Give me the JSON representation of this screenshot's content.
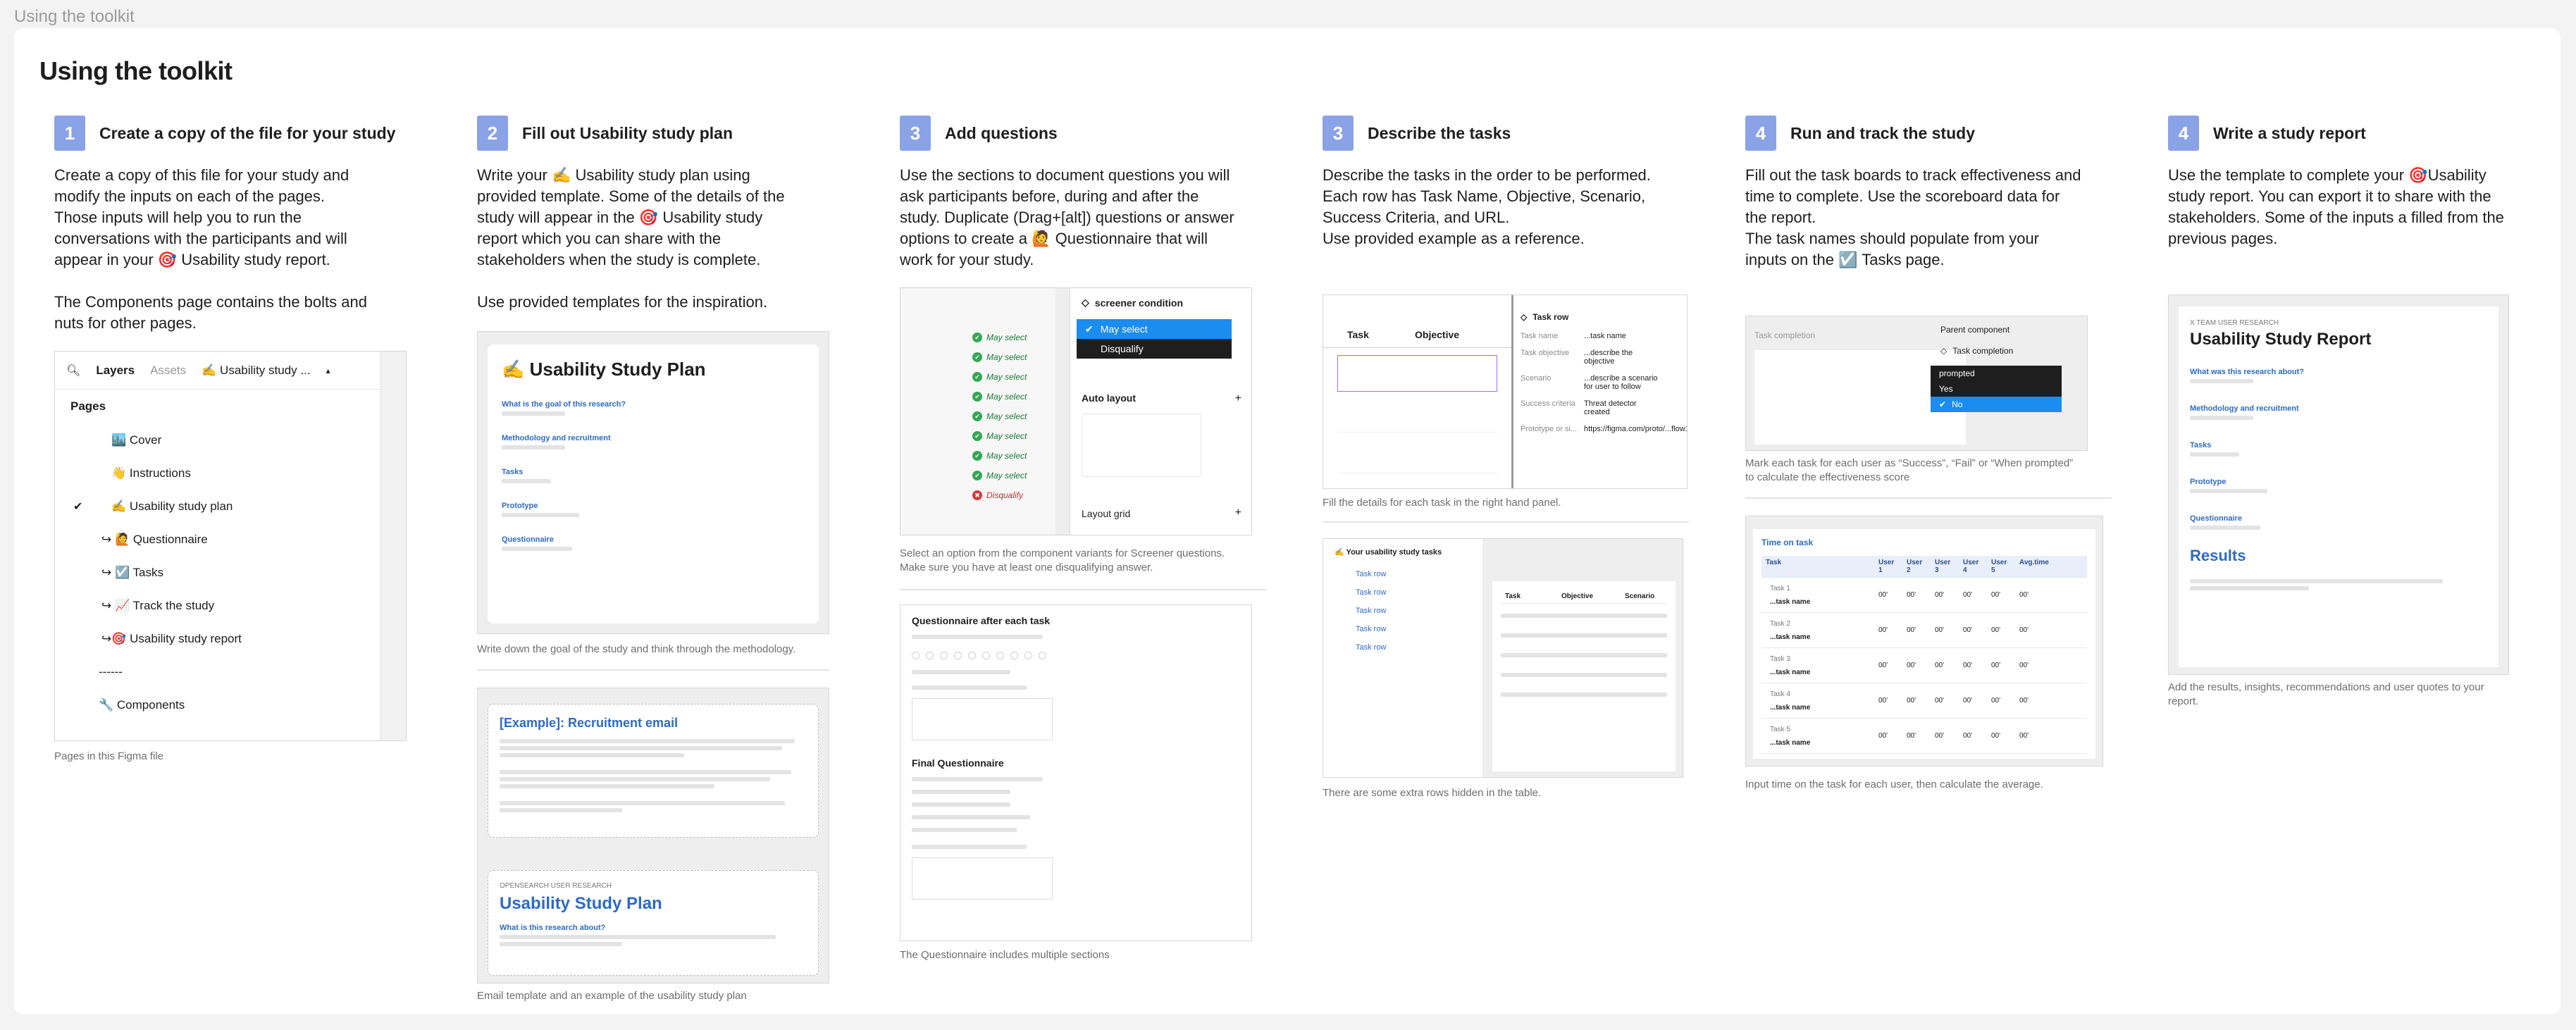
{
  "frame_label": "Using the toolkit",
  "title": "Using the toolkit",
  "columns": [
    {
      "num": "1",
      "title": "Create a copy of the file for your study",
      "desc": "Create a copy of this file for your study and\nmodify the inputs on each of the pages.\nThose inputs will help you to run the\nconversations with the participants and will\nappear in your 🎯 Usability study report.\n\nThe Components page contains the bolts and\nnuts for other pages.",
      "captions": [
        "Pages in this Figma file"
      ]
    },
    {
      "num": "2",
      "title": "Fill out Usability study plan",
      "desc": "Write your ✍️ Usability study plan using\nprovided template. Some of the details of the\nstudy will appear in the 🎯 Usability study\nreport which you can share with the\nstakeholders when the study is complete.\n\nUse provided templates for the inspiration.",
      "captions": [
        "Write down the goal of the study and think through the methodology.",
        "Email template and  an example of the usability study plan"
      ]
    },
    {
      "num": "3",
      "title": "Add questions",
      "desc": "Use the sections to document questions you will\nask participants before, during and after the\nstudy. Duplicate (Drag+[alt]) questions or answer\noptions to create a 🙋 Questionnaire that will\nwork for your study.",
      "captions": [
        "Select an option from the component variants for Screener questions.\nMake sure you have at least one disqualifying answer.",
        "The Questionnaire includes multiple sections"
      ]
    },
    {
      "num": "3",
      "title": "Describe the tasks",
      "desc": "Describe the tasks in the order to be performed.\nEach row has Task Name, Objective, Scenario,\nSuccess Criteria, and URL.\nUse provided example as a reference.",
      "captions": [
        "Fill the details for each task in the right hand panel.",
        "There are some extra rows hidden in the table."
      ]
    },
    {
      "num": "4",
      "title": "Run and track the study",
      "desc": "Fill out the task boards to track effectiveness and\ntime to complete. Use the scoreboard data for\nthe report.\nThe task names should populate from your\ninputs on the ☑️ Tasks page.",
      "captions": [
        "Mark each task for each user as “Success”, “Fail” or “When prompted”\nto calculate the effectiveness score",
        "Input time on the task for each user, then calculate the average."
      ]
    },
    {
      "num": "4",
      "title": "Write a study report",
      "desc": "Use the template to complete your 🎯Usability\nstudy report. You can export it to share with the\nstakeholders. Some of the inputs a filled from the\nprevious pages.",
      "captions": [
        "Add the results, insights, recommendations and user quotes to your\nreport."
      ]
    }
  ],
  "layers_panel": {
    "tabs": [
      "Layers",
      "Assets",
      "✍️ Usability study ..."
    ],
    "pages_label": "Pages",
    "add": "+",
    "pages": [
      "🏙️ Cover",
      "👋 Instructions",
      "✍️ Usability study plan",
      "↪ 🙋 Questionnaire",
      "↪ ☑️ Tasks",
      "↪ 📈 Track the study",
      "↪🎯 Usability study report",
      "------",
      "🔧 Components"
    ]
  },
  "plan_mock": {
    "title": "✍️ Usability Study Plan",
    "sections": [
      "What is the goal of this research?",
      "Methodology and recruitment",
      "Tasks",
      "Prototype",
      "Questionnaire"
    ]
  },
  "email_mock": {
    "title": "[Example]: Recruitment email",
    "eyebrow": "OPENSEARCH USER RESEARCH",
    "plan_title": "Usability Study Plan",
    "question": "What is this research about?"
  },
  "screener_mock": {
    "condition": "screener condition",
    "options": [
      "May select",
      "Disqualify"
    ],
    "auto_layout": "Auto layout",
    "layout_grid": "Layout grid",
    "rows": [
      "May select",
      "May select",
      "May select",
      "May select",
      "May select",
      "May select",
      "May select",
      "May select",
      "Disqualify"
    ]
  },
  "questionnaire_mock": {
    "title1": "Questionnaire after each task",
    "title2": "Final Questionnaire"
  },
  "tasks_mock": {
    "headers": [
      "Task",
      "Objective"
    ],
    "panel_title": "Task row",
    "fields": [
      [
        "Task name",
        "...task name"
      ],
      [
        "Task objective",
        "...describe the objective"
      ],
      [
        "Scenario",
        "...describe a scenario for user to follow"
      ],
      [
        "Success criteria",
        "Threat detector created"
      ],
      [
        "Prototype or si...",
        "https://figma.com/proto/...flow1"
      ]
    ],
    "list_title": "✍️ Your usability study tasks",
    "rows": [
      "Task row",
      "Task row",
      "Task row",
      "Task row",
      "Task row"
    ]
  },
  "track_mock": {
    "title": "Task completion",
    "options": [
      "prompted",
      "Yes",
      "No"
    ],
    "parent": "Parent component",
    "comp": "Task completion",
    "time_title": "Time on task",
    "headers": [
      "Task",
      "User 1",
      "User 2",
      "User 3",
      "User 4",
      "User 5",
      "Avg.time"
    ],
    "tasks": [
      "Task 1",
      "Task 2",
      "Task 3",
      "Task 4",
      "Task 5"
    ],
    "task_name": "...task name",
    "cell": "00'"
  },
  "report_mock": {
    "eyebrow": "X TEAM USER RESEARCH",
    "title": "Usability Study Report",
    "sections": [
      "What was this research about?",
      "Methodology and recruitment",
      "Tasks",
      "Prototype",
      "Questionnaire"
    ],
    "results": "Results"
  }
}
